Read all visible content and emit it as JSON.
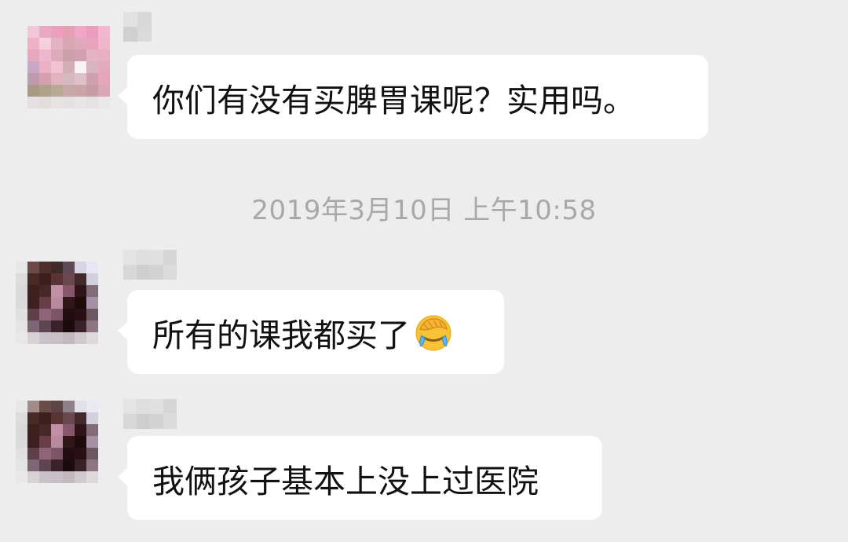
{
  "messages": [
    {
      "text": "你们有没有买脾胃课呢？实用吗。",
      "avatar": "pink-pixelated",
      "sender": "redacted"
    },
    {
      "text": "所有的课我都买了",
      "emoji": "face-palm-tears-emoji",
      "avatar": "dark-pixelated",
      "sender": "redacted"
    },
    {
      "text": "我俩孩子基本上没上过医院",
      "avatar": "dark-pixelated",
      "sender": "redacted"
    }
  ],
  "timestamp": "2019年3月10日 上午10:58",
  "colors": {
    "background": "#ededed",
    "bubble": "#ffffff",
    "timestamp_text": "#a8a8a8",
    "message_text": "#111111"
  }
}
